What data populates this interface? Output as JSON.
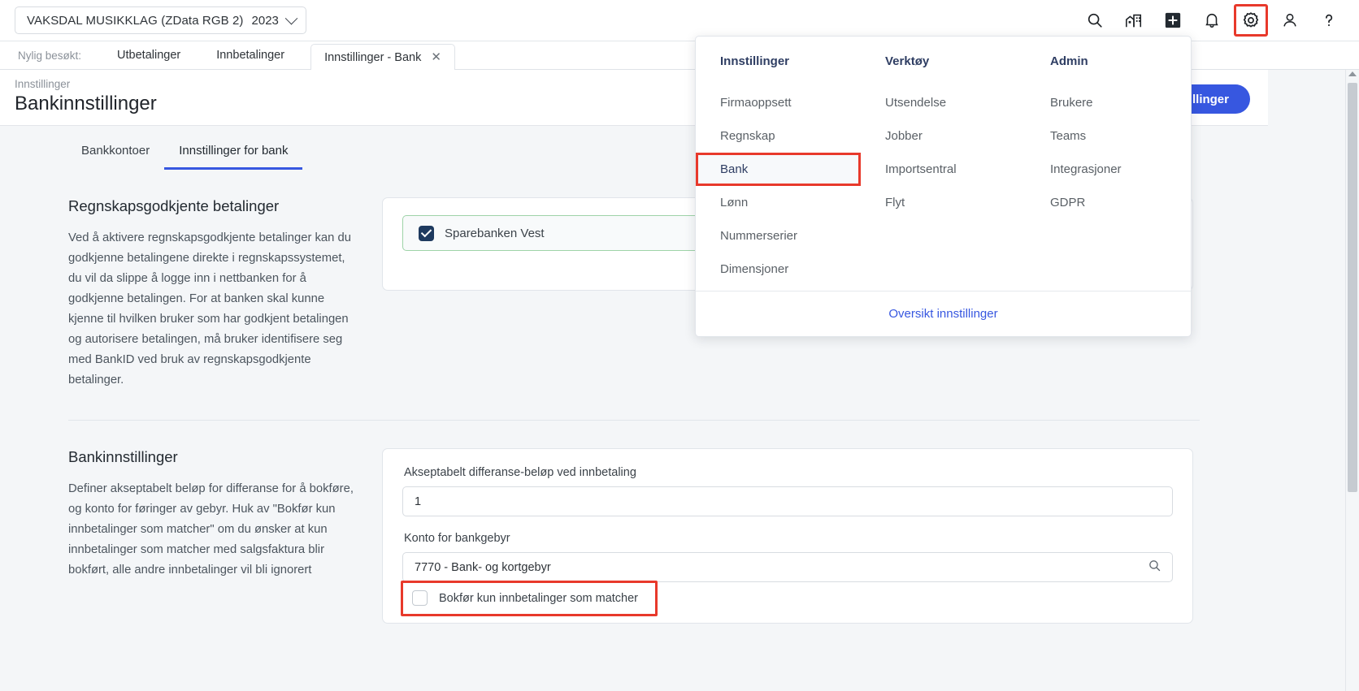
{
  "topbar": {
    "company": "VAKSDAL MUSIKKLAG (ZData RGB 2)",
    "year": "2023",
    "icons": [
      {
        "name": "search-icon",
        "title": "Søk"
      },
      {
        "name": "company-icon",
        "title": "Firma"
      },
      {
        "name": "plus-icon",
        "title": "Ny"
      },
      {
        "name": "bell-icon",
        "title": "Varsler"
      },
      {
        "name": "gear-icon",
        "title": "Innstillinger"
      },
      {
        "name": "user-icon",
        "title": "Bruker"
      },
      {
        "name": "help-icon",
        "title": "Hjelp"
      }
    ]
  },
  "tabstrip": {
    "recent_label": "Nylig besøkt:",
    "recent": [
      "Utbetalinger",
      "Innbetalinger"
    ],
    "active_tab": "Innstillinger - Bank",
    "close_glyph": "✕"
  },
  "page": {
    "breadcrumb": "Innstillinger",
    "title": "Bankinnstillinger",
    "save_button": "Lagre innstillinger"
  },
  "subtabs": [
    {
      "label": "Bankkontoer",
      "active": false
    },
    {
      "label": "Innstillinger for bank",
      "active": true
    }
  ],
  "section_approved": {
    "heading": "Regnskapsgodkjente betalinger",
    "paragraph": "Ved å aktivere regnskapsgodkjente betalinger kan du godkjenne betalingene direkte i regnskapssystemet, du vil da slippe å logge inn i nettbanken for å godkjenne betalingen. For at banken skal kunne kjenne til hvilken bruker som har godkjent betalingen og autorisere betalingen, må bruker identifisere seg med BankID ved bruk av regnskapsgodkjente betalinger.",
    "bank_row": {
      "label": "Sparebanken Vest",
      "checked": true
    }
  },
  "section_settings": {
    "heading": "Bankinnstillinger",
    "paragraph": "Definer akseptabelt beløp for differanse for å bokføre, og konto for føringer av gebyr. Huk av \"Bokfør kun innbetalinger som matcher\" om du ønsker at kun innbetalinger som matcher med salgsfaktura blir bokført, alle andre innbetalinger vil bli ignorert",
    "fields": [
      {
        "label": "Akseptabelt differanse-beløp ved innbetaling",
        "value": "1",
        "has_search_icon": false
      },
      {
        "label": "Konto for bankgebyr",
        "value": "7770 - Bank- og kortgebyr",
        "has_search_icon": true
      }
    ],
    "checkbox": {
      "label": "Bokfør kun innbetalinger som matcher",
      "checked": false
    }
  },
  "dropdown": {
    "columns": [
      {
        "heading": "Innstillinger",
        "items": [
          "Firmaoppsett",
          "Regnskap",
          "Bank",
          "Lønn",
          "Nummerserier",
          "Dimensjoner"
        ]
      },
      {
        "heading": "Verktøy",
        "items": [
          "Utsendelse",
          "Jobber",
          "Importsentral",
          "Flyt"
        ]
      },
      {
        "heading": "Admin",
        "items": [
          "Brukere",
          "Teams",
          "Integrasjoner",
          "GDPR"
        ]
      }
    ],
    "selected_item": "Bank",
    "footer_link": "Oversikt innstillinger"
  },
  "colors": {
    "accent_blue": "#3757e0",
    "highlight_red": "#e8392b",
    "heading_navy": "#2f3e63",
    "page_bg": "#f4f6f8",
    "checkbox_on": "#1e3a5f",
    "bank_row_border": "#9ed3a8"
  }
}
